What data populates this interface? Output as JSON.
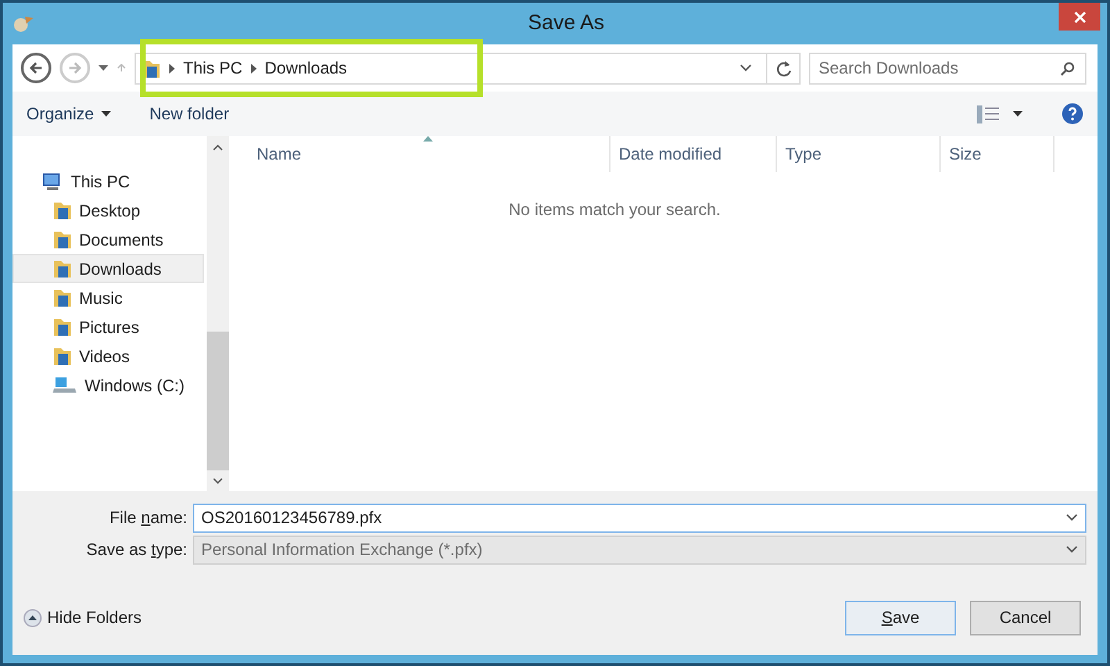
{
  "window": {
    "title": "Save As"
  },
  "address": {
    "path": [
      "This PC",
      "Downloads"
    ],
    "highlighted": true
  },
  "search": {
    "placeholder": "Search Downloads"
  },
  "toolbar": {
    "organize": "Organize",
    "new_folder": "New folder"
  },
  "tree": [
    {
      "label": "This PC",
      "kind": "computer",
      "selected": false,
      "children": [
        {
          "label": "Desktop",
          "kind": "folder",
          "selected": false
        },
        {
          "label": "Documents",
          "kind": "folder",
          "selected": false
        },
        {
          "label": "Downloads",
          "kind": "folder",
          "selected": true
        },
        {
          "label": "Music",
          "kind": "folder",
          "selected": false
        },
        {
          "label": "Pictures",
          "kind": "folder",
          "selected": false
        },
        {
          "label": "Videos",
          "kind": "folder",
          "selected": false
        },
        {
          "label": "Windows (C:)",
          "kind": "drive",
          "selected": false
        }
      ]
    }
  ],
  "table": {
    "columns": [
      "Name",
      "Date modified",
      "Type",
      "Size"
    ],
    "empty_message": "No items match your search."
  },
  "file_name": {
    "label": {
      "before": "File ",
      "key": "n",
      "after": "ame:"
    },
    "value": "OS20160123456789.pfx"
  },
  "save_type": {
    "label": {
      "before": "Save as ",
      "key": "t",
      "after": "ype:"
    },
    "value": "Personal Information Exchange (*.pfx)",
    "disabled": true
  },
  "hide_folders": "Hide Folders",
  "buttons": [
    {
      "label": {
        "key": "S",
        "after": "ave"
      },
      "default": true
    },
    {
      "label": {
        "after": "Cancel"
      },
      "default": false
    }
  ]
}
